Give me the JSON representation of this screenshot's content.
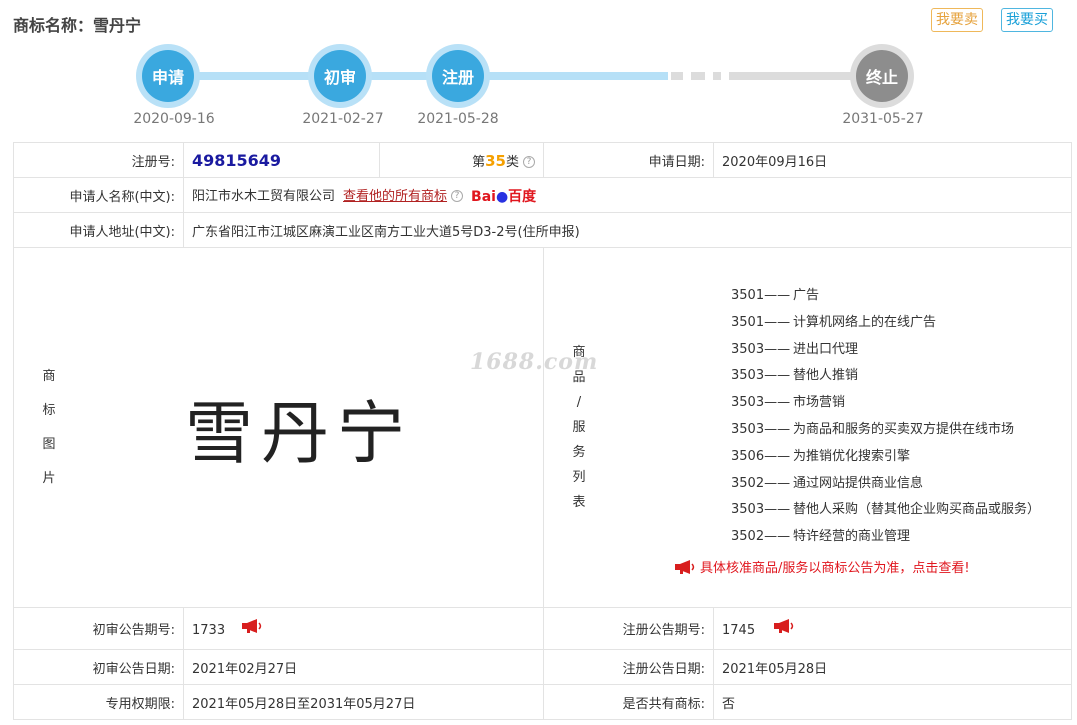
{
  "header": {
    "title": "商标名称：雪丹宁",
    "sell_label": "我要卖",
    "buy_label": "我要买"
  },
  "timeline": {
    "steps": [
      {
        "label": "申请",
        "date": "2020-09-16"
      },
      {
        "label": "初审",
        "date": "2021-02-27"
      },
      {
        "label": "注册",
        "date": "2021-05-28"
      },
      {
        "label": "终止",
        "date": "2031-05-27"
      }
    ]
  },
  "info": {
    "reg_no_label": "注册号:",
    "reg_no": "49815649",
    "class_prefix": "第",
    "class_no": "35",
    "class_suffix": "类",
    "apply_date_label": "申请日期:",
    "apply_date": "2020年09月16日",
    "applicant_label": "申请人名称(中文):",
    "applicant": "阳江市水木工贸有限公司",
    "view_all_link": "查看他的所有商标",
    "baidu_logo": "Bai百度",
    "address_label": "申请人地址(中文):",
    "address": "广东省阳江市江城区麻演工业区南方工业大道5号D3-2号(住所申报)",
    "mark_image_label": [
      "商",
      "标",
      "图",
      "片"
    ],
    "mark_text": "雪丹宁",
    "service_label": [
      "商",
      "品",
      "/",
      "服",
      "务",
      "列",
      "表"
    ],
    "services": [
      {
        "code": "3501——",
        "name": "广告"
      },
      {
        "code": "3501——",
        "name": "计算机网络上的在线广告"
      },
      {
        "code": "3503——",
        "name": "进出口代理"
      },
      {
        "code": "3503——",
        "name": "替他人推销"
      },
      {
        "code": "3503——",
        "name": "市场营销"
      },
      {
        "code": "3503——",
        "name": "为商品和服务的买卖双方提供在线市场"
      },
      {
        "code": "3506——",
        "name": "为推销优化搜索引擎"
      },
      {
        "code": "3502——",
        "name": "通过网站提供商业信息"
      },
      {
        "code": "3503——",
        "name": "替他人采购（替其他企业购买商品或服务）"
      },
      {
        "code": "3502——",
        "name": "特许经营的商业管理"
      }
    ],
    "notice": "具体核准商品/服务以商标公告为准，点击查看!",
    "watermark": "1688.com",
    "prelim_no_label": "初审公告期号:",
    "prelim_no": "1733",
    "reg_notice_no_label": "注册公告期号:",
    "reg_notice_no": "1745",
    "prelim_date_label": "初审公告日期:",
    "prelim_date": "2021年02月27日",
    "reg_notice_date_label": "注册公告日期:",
    "reg_notice_date": "2021年05月28日",
    "exclusive_label": "专用权期限:",
    "exclusive_period": "2021年05月28日至2031年05月27日",
    "shared_label": "是否共有商标:",
    "shared": "否"
  },
  "colors": {
    "step_blue": "#3aa8df",
    "step_grey": "#8d8d8d",
    "accent_red": "#e0161e",
    "class_orange": "#f5a000"
  }
}
